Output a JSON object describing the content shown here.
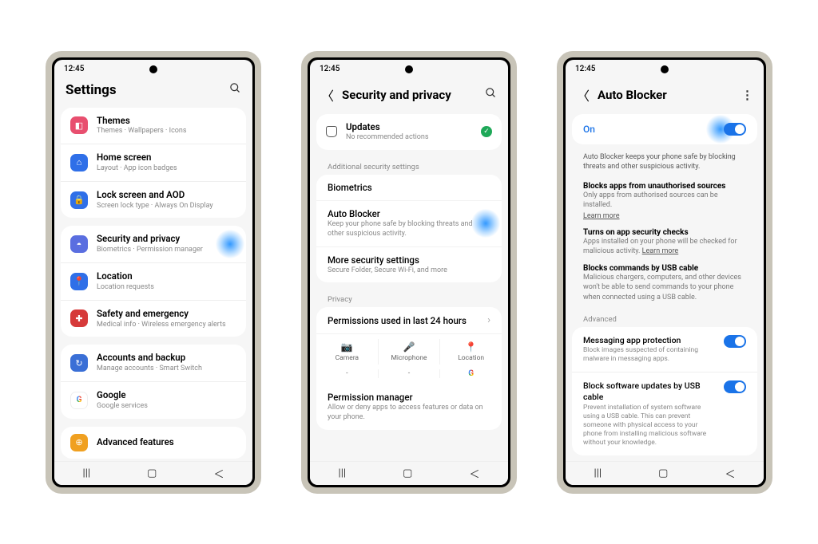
{
  "status_time": "12:45",
  "screen1": {
    "title": "Settings",
    "items": [
      {
        "icon_bg": "#e84f6f",
        "icon_name": "themes-icon",
        "glyph": "◧",
        "title": "Themes",
        "sub": "Themes · Wallpapers · Icons"
      },
      {
        "icon_bg": "#2f6fe8",
        "icon_name": "home-icon",
        "glyph": "⌂",
        "title": "Home screen",
        "sub": "Layout · App icon badges"
      },
      {
        "icon_bg": "#2f6fe8",
        "icon_name": "lock-icon",
        "glyph": "🔒",
        "title": "Lock screen and AOD",
        "sub": "Screen lock type · Always On Display"
      },
      {
        "icon_bg": "#5a6ee0",
        "icon_name": "shield-icon",
        "glyph": "◓",
        "title": "Security and privacy",
        "sub": "Biometrics · Permission manager",
        "highlight": true
      },
      {
        "icon_bg": "#2f6fe8",
        "icon_name": "location-icon",
        "glyph": "📍",
        "title": "Location",
        "sub": "Location requests"
      },
      {
        "icon_bg": "#d63a3a",
        "icon_name": "emergency-icon",
        "glyph": "✚",
        "title": "Safety and emergency",
        "sub": "Medical info · Wireless emergency alerts"
      },
      {
        "icon_bg": "#3a6fd6",
        "icon_name": "accounts-icon",
        "glyph": "↻",
        "title": "Accounts and backup",
        "sub": "Manage accounts · Smart Switch"
      },
      {
        "icon_bg": "#ffffff",
        "icon_name": "google-icon",
        "glyph": "G",
        "title": "Google",
        "sub": "Google services"
      },
      {
        "icon_bg": "#f0a020",
        "icon_name": "advanced-icon",
        "glyph": "⊕",
        "title": "Advanced features",
        "sub": ""
      }
    ]
  },
  "screen2": {
    "title": "Security and privacy",
    "updates_title": "Updates",
    "updates_sub": "No recommended actions",
    "section1": "Additional security settings",
    "biometrics": "Biometrics",
    "autoblocker_title": "Auto Blocker",
    "autoblocker_sub": "Keep your phone safe by blocking threats and other suspicious activity.",
    "more_title": "More security settings",
    "more_sub": "Secure Folder, Secure Wi-Fi, and more",
    "section2": "Privacy",
    "perm_title": "Permissions used in last 24 hours",
    "perm_cols": [
      "Camera",
      "Microphone",
      "Location"
    ],
    "perm_vals": [
      "-",
      "-",
      "G"
    ],
    "pm_title": "Permission manager",
    "pm_sub": "Allow or deny apps to access features or data on your phone."
  },
  "screen3": {
    "title": "Auto Blocker",
    "on_label": "On",
    "desc": "Auto Blocker keeps your phone safe by blocking threats and other suspicious activity.",
    "f1_title": "Blocks apps from unauthorised sources",
    "f1_sub": "Only apps from authorised sources can be installed.",
    "f2_title": "Turns on app security checks",
    "f2_sub": "Apps installed on your phone will be checked for malicious activity.",
    "f3_title": "Blocks commands by USB cable",
    "f3_sub": "Malicious chargers, computers, and other devices won't be able to send commands to your phone when connected using a USB cable.",
    "learn_more": "Learn more",
    "advanced_label": "Advanced",
    "a1_title": "Messaging app protection",
    "a1_sub": "Block images suspected of containing malware in messaging apps.",
    "a2_title": "Block software updates by USB cable",
    "a2_sub": "Prevent installation of system software using a USB cable. This can prevent someone with physical access to your phone from installing malicious software without your knowledge."
  }
}
